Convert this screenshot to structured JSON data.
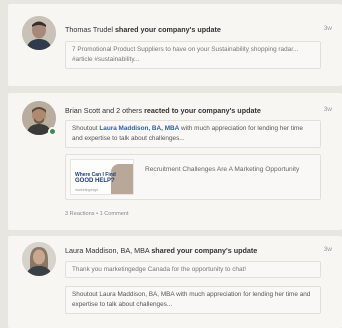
{
  "notifications": [
    {
      "name": "Thomas Trudel",
      "action": "shared your company's update",
      "time": "3w",
      "snippet": "7 Promotional Product Suppliers to have on your Sustainability shopping radar... #article #sustainability..."
    },
    {
      "name": "Brian Scott and 2 others",
      "action": "reacted to your company's update",
      "time": "3w",
      "snippet_prefix": "Shoutout",
      "snippet_mention": "Laura Maddison, BA, MBA",
      "snippet_suffix": "with much appreciation for lending her time and expertise to talk about challenges...",
      "share": {
        "thumb_line1": "Where Can I Find",
        "thumb_line2": "GOOD HELP?",
        "thumb_line3": "marketingedge",
        "title": "Recruitment Challenges Are A Marketing Opportunity"
      },
      "stats": "3 Reactions • 1 Comment"
    },
    {
      "name": "Laura Maddison, BA, MBA",
      "action": "shared your company's update",
      "time": "3w",
      "comment": "Thank you marketingedge Canada for the opportunity to chat!",
      "snippet": "Shoutout Laura Maddison, BA, MBA with much appreciation for lending her time and expertise to talk about challenges..."
    }
  ],
  "colors": {
    "mention": "#2f5da8",
    "online_badge": "#3a8a54",
    "card_bg": "#f7f6f3",
    "page_bg": "#e8e6e1"
  }
}
